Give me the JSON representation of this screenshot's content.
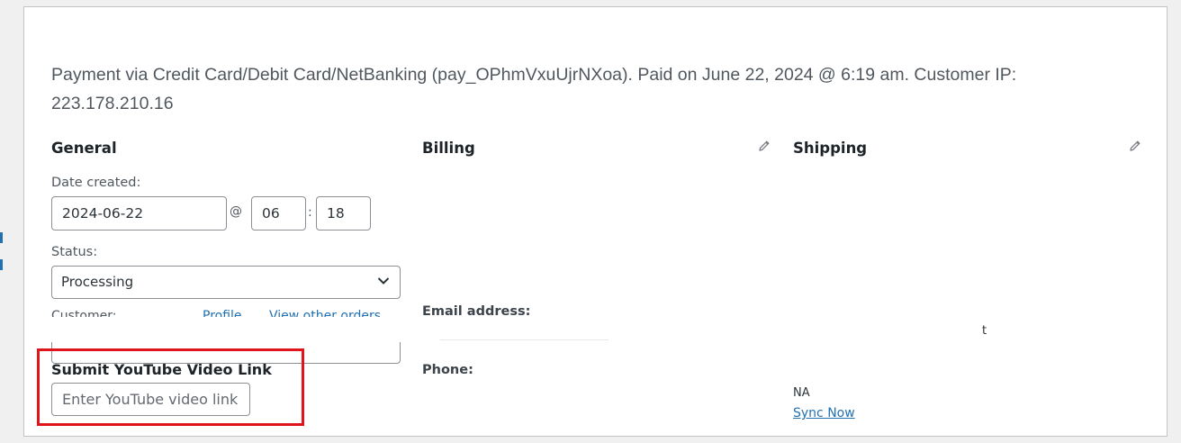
{
  "order": {
    "payment_info": "Payment via Credit Card/Debit Card/NetBanking (pay_OPhmVxuUjrNXoa). Paid on June 22, 2024 @ 6:19 am. Customer IP: 223.178.210.16"
  },
  "general": {
    "title": "General",
    "date_created_label": "Date created:",
    "date_value": "2024-06-22",
    "at_separator": "@",
    "hour_value": "06",
    "time_separator": ":",
    "minute_value": "18",
    "status_label": "Status:",
    "status_value": "Processing",
    "customer_label": "Customer:",
    "profile_link": "Profile",
    "view_orders_link": "View other orders"
  },
  "youtube": {
    "heading": "Submit YouTube Video Link",
    "placeholder": "Enter YouTube video link",
    "highlight_color": "#e0141b"
  },
  "billing": {
    "title": "Billing",
    "email_label": "Email address:",
    "email_value": "",
    "phone_label": "Phone:"
  },
  "shipping": {
    "title": "Shipping",
    "fragment": "t",
    "na_text": "NA",
    "sync_link": "Sync Now"
  },
  "icons": {
    "edit": "pencil-icon",
    "dropdown": "chevron-down-icon"
  },
  "colors": {
    "link": "#2271b1",
    "border": "#8c8f94",
    "highlight": "#e0141b"
  }
}
